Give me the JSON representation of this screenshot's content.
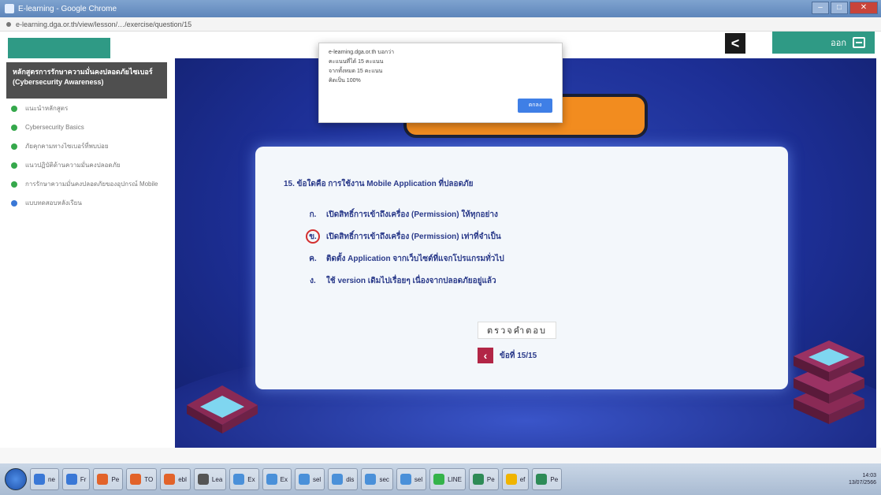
{
  "window": {
    "title": "E-learning - Google Chrome"
  },
  "urlbar": {
    "text": "e-learning.dga.or.th/view/lesson/…/exercise/question/15"
  },
  "sidebar": {
    "course_title": "หลักสูตรการรักษาความมั่นคงปลอดภัยไซเบอร์ (Cybersecurity Awareness)",
    "items": [
      {
        "label": "แนะนำหลักสูตร",
        "status": "green"
      },
      {
        "label": "Cybersecurity Basics",
        "status": "green"
      },
      {
        "label": "ภัยคุกคามทางไซเบอร์ที่พบบ่อย",
        "status": "green"
      },
      {
        "label": "แนวปฏิบัติด้านความมั่นคงปลอดภัย",
        "status": "green"
      },
      {
        "label": "การรักษาความมั่นคงปลอดภัยของอุปกรณ์ Mobile",
        "status": "green"
      },
      {
        "label": "แบบทดสอบหลังเรียน",
        "status": "blue"
      }
    ]
  },
  "header": {
    "back_glyph": "<",
    "exit_label": "ออก"
  },
  "dialog": {
    "site": "e-learning.dga.or.th บอกว่า",
    "line1": "คะแนนที่ได้ 15 คะแนน",
    "line2": "จากทั้งหมด 15 คะแนน",
    "line3": "คิดเป็น 100%",
    "ok_label": "ตกลง"
  },
  "question": {
    "title": "15. ข้อใดคือ การใช้งาน Mobile Application ที่ปลอดภัย",
    "choices": [
      {
        "marker": "ก.",
        "text": "เปิดสิทธิ์การเข้าถึงเครื่อง (Permission) ให้ทุกอย่าง",
        "selected": false
      },
      {
        "marker": "ข.",
        "text": "เปิดสิทธิ์การเข้าถึงเครื่อง (Permission) เท่าที่จำเป็น",
        "selected": true
      },
      {
        "marker": "ค.",
        "text": "ติดตั้ง Application จากเว็บไซต์ที่แจกโปรแกรมทั่วไป",
        "selected": false
      },
      {
        "marker": "ง.",
        "text": "ใช้ version เดิมไปเรื่อยๆ เนื่องจากปลอดภัยอยู่แล้ว",
        "selected": false
      }
    ],
    "check_label": "ตรวจคำตอบ",
    "page_label": "ข้อที่ 15/15"
  },
  "taskbar": {
    "items": [
      "ne",
      "Fr",
      "Pe",
      "TO",
      "ebl",
      "Lea",
      "Ex",
      "Ex",
      "sel",
      "dis",
      "sec",
      "sel",
      "LINE",
      "Pe",
      "ef",
      "Pe"
    ],
    "clock_time": "14:03",
    "clock_date": "13/07/2566"
  },
  "colors": {
    "accent": "#2f9a85",
    "card_text": "#2a3a8a",
    "selected_ring": "#d32f2f",
    "banner": "#f28c1f"
  }
}
